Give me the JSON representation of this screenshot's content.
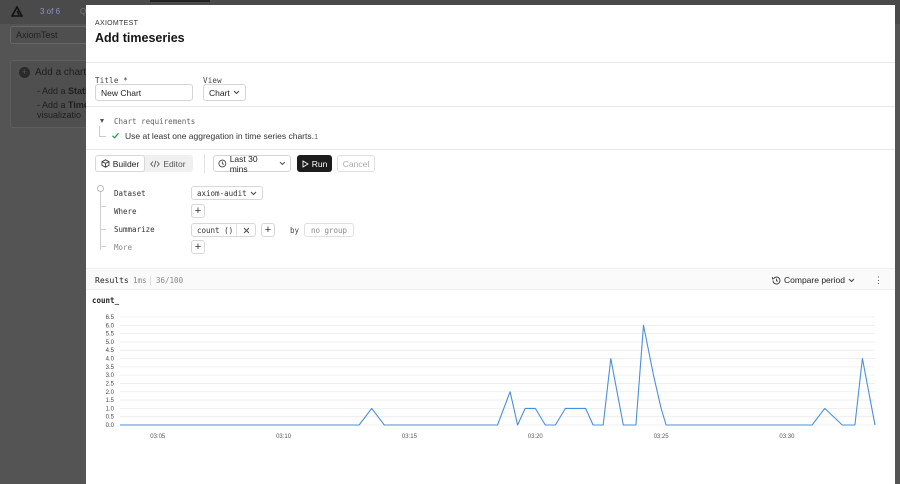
{
  "background": {
    "pager": "3 of 6",
    "search_hint": "Q",
    "tab_input": "AxiomTest",
    "add_chart": "Add a chart",
    "line1_prefix": "- Add a ",
    "line1_bold": "Stati",
    "line2_prefix": "- Add a ",
    "line2_bold": "Time",
    "line3": "visualizatio"
  },
  "modal": {
    "brand": "AXIOMTEST",
    "title": "Add timeseries"
  },
  "form": {
    "title_label": "Title *",
    "title_value": "New Chart",
    "view_label": "View",
    "view_value": "Chart"
  },
  "requirements": {
    "label": "Chart requirements",
    "item": "Use at least one aggregation in time series charts.",
    "count": "1"
  },
  "toolbar": {
    "builder": "Builder",
    "editor": "Editor",
    "time_range": "Last 30 mins",
    "run": "Run",
    "cancel": "Cancel"
  },
  "builder": {
    "dataset_label": "Dataset",
    "dataset_value": "axiom-audit",
    "where_label": "Where",
    "summarize_label": "Summarize",
    "aggregation": "count ()",
    "by_label": "by",
    "group_placeholder": "no group",
    "more_label": "More"
  },
  "results": {
    "label": "Results",
    "elapsed": "1ms",
    "rows": "36/100",
    "compare": "Compare period"
  },
  "colors": {
    "line": "#4a90d9",
    "run_bg": "#1c1c1c",
    "check": "#2e9e58"
  },
  "chart_data": {
    "type": "line",
    "title": "count_",
    "ylim": [
      0,
      6.5
    ],
    "yticks": [
      "0.0",
      "0.5",
      "1.0",
      "1.5",
      "2.0",
      "2.5",
      "3.0",
      "3.5",
      "4.0",
      "4.5",
      "5.0",
      "5.5",
      "6.0",
      "6.5"
    ],
    "xticks": [
      "03:05",
      "03:10",
      "03:15",
      "03:20",
      "03:25",
      "03:30"
    ],
    "xlim": [
      3.5,
      33.5
    ],
    "grid": true,
    "series": [
      {
        "x": [
          3.5,
          13.0,
          13.5,
          14.0,
          18.5,
          19.0,
          19.3,
          19.6,
          20.0,
          20.4,
          20.8,
          21.2,
          21.5,
          22.0,
          22.3,
          22.7,
          23.0,
          23.5,
          24.0,
          24.3,
          24.7,
          25.0,
          25.2,
          25.6,
          26.0,
          26.3,
          26.6,
          27.0,
          27.7,
          30.5,
          31.0,
          31.5,
          32.2,
          32.7,
          33.0,
          33.5,
          34.0
        ],
        "y": [
          0,
          0,
          1,
          0,
          0,
          2,
          0,
          1,
          1,
          0,
          0,
          1,
          1,
          1,
          0,
          0,
          4,
          0,
          0,
          6,
          3,
          1,
          0,
          0,
          0,
          0,
          0,
          0,
          0,
          0,
          0,
          1,
          0,
          0,
          4,
          0,
          0
        ]
      }
    ]
  }
}
